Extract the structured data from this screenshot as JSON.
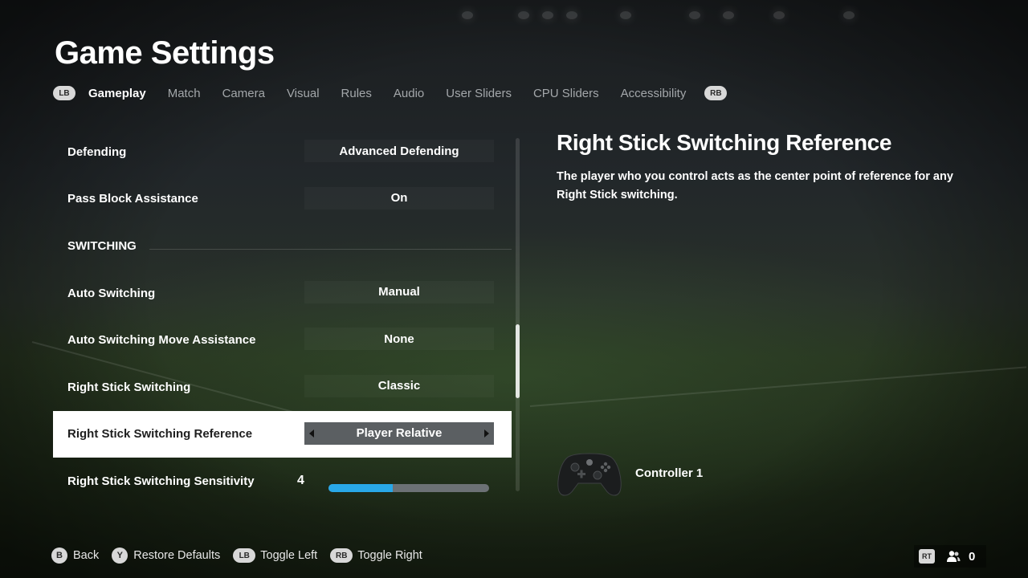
{
  "page_title": "Game Settings",
  "tabs": {
    "lb_badge": "LB",
    "rb_badge": "RB",
    "items": [
      {
        "label": "Gameplay",
        "active": true
      },
      {
        "label": "Match"
      },
      {
        "label": "Camera"
      },
      {
        "label": "Visual"
      },
      {
        "label": "Rules"
      },
      {
        "label": "Audio"
      },
      {
        "label": "User Sliders"
      },
      {
        "label": "CPU Sliders"
      },
      {
        "label": "Accessibility"
      }
    ]
  },
  "settings": {
    "defending": {
      "label": "Defending",
      "value": "Advanced Defending"
    },
    "pass_block": {
      "label": "Pass Block Assistance",
      "value": "On"
    },
    "section_switching": {
      "label": "SWITCHING"
    },
    "auto_switching": {
      "label": "Auto Switching",
      "value": "Manual"
    },
    "auto_switching_move": {
      "label": "Auto Switching Move Assistance",
      "value": "None"
    },
    "right_stick_switching": {
      "label": "Right Stick Switching",
      "value": "Classic"
    },
    "right_stick_reference": {
      "label": "Right Stick Switching Reference",
      "value": "Player Relative"
    },
    "right_stick_sensitivity": {
      "label": "Right Stick Switching Sensitivity",
      "value": "4",
      "level_fraction": 0.4
    }
  },
  "description": {
    "title": "Right Stick Switching Reference",
    "text": "The player who you control acts as the center point of reference for any Right Stick switching."
  },
  "controller": {
    "label": "Controller 1",
    "icon": "gamepad-icon"
  },
  "footer": {
    "back": {
      "badge": "B",
      "label": "Back"
    },
    "restore": {
      "badge": "Y",
      "label": "Restore Defaults"
    },
    "toggle_left": {
      "badge": "LB",
      "label": "Toggle Left"
    },
    "toggle_right": {
      "badge": "RB",
      "label": "Toggle Right"
    }
  },
  "status": {
    "rt_badge": "RT",
    "icon": "people-icon",
    "count": "0"
  },
  "colors": {
    "slider_fill": "#29a8e8",
    "selected_row": "#ffffff",
    "inactive_tab": "#a3a7aa"
  }
}
